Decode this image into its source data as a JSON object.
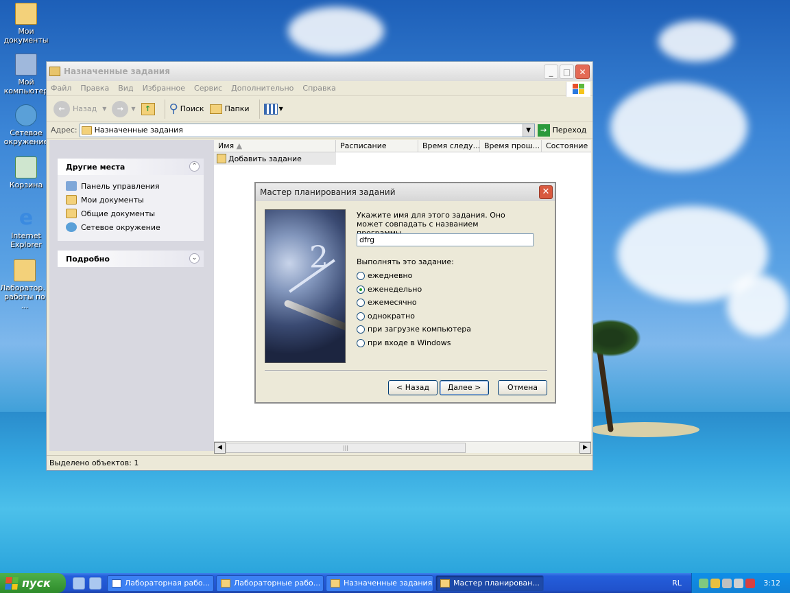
{
  "desktop": {
    "icons": [
      {
        "label": "Мои документы"
      },
      {
        "label": "Мой компьютер"
      },
      {
        "label": "Сетевое окружение"
      },
      {
        "label": "Корзина"
      },
      {
        "label": "Internet Explorer"
      },
      {
        "label": "Лаборатор... работы по ..."
      }
    ]
  },
  "window": {
    "title": "Назначенные задания",
    "menu": [
      "Файл",
      "Правка",
      "Вид",
      "Избранное",
      "Сервис",
      "Дополнительно",
      "Справка"
    ],
    "toolbar": {
      "back": "Назад",
      "search": "Поиск",
      "folders": "Папки"
    },
    "address": {
      "label": "Адрес:",
      "value": "Назначенные задания",
      "go": "Переход"
    },
    "left_panels": {
      "other_places": {
        "title": "Другие места",
        "items": [
          "Панель управления",
          "Мои документы",
          "Общие документы",
          "Сетевое окружение"
        ]
      },
      "details": {
        "title": "Подробно"
      }
    },
    "columns": [
      "Имя",
      "Расписание",
      "Время следу...",
      "Время прош...",
      "Состояние"
    ],
    "rows": [
      "Добавить задание"
    ],
    "status": "Выделено объектов: 1"
  },
  "dialog": {
    "title": "Мастер планирования заданий",
    "prompt": "Укажите имя для этого задания. Оно может совпадать с названием программы.",
    "name_value": "dfrg",
    "run_label": "Выполнять это задание:",
    "options": [
      "ежедневно",
      "еженедельно",
      "ежемесячно",
      "однократно",
      "при загрузке компьютера",
      "при входе в Windows"
    ],
    "selected_option": "еженедельно",
    "image_number": "2",
    "buttons": {
      "back": "< Назад",
      "next": "Далее >",
      "cancel": "Отмена"
    }
  },
  "taskbar": {
    "start": "пуск",
    "tasks": [
      "Лабораторная рабо...",
      "Лабораторные рабо...",
      "Назначенные задания",
      "Мастер планирован..."
    ],
    "active_task": "Мастер планирован...",
    "lang": "RL",
    "clock": "3:12"
  }
}
